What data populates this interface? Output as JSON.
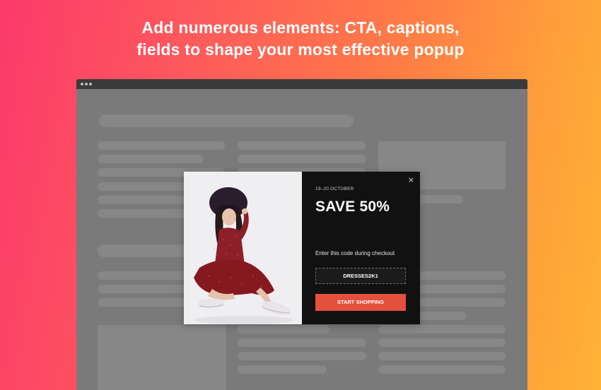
{
  "headline": {
    "line1": "Add numerous elements: CTA, captions,",
    "line2": "fields to shape your most effective popup"
  },
  "popup": {
    "date": "19–20 OCTOBER",
    "title": "SAVE 50%",
    "instruction": "Enter this code during checkout",
    "code": "DRESSES2K1",
    "cta_label": "START SHOPPING",
    "close_symbol": "×",
    "accent_color": "#e4503c",
    "panel_color": "#111112",
    "image_subject": "woman in red polka-dot dress and black hat sitting"
  },
  "background_gradient": [
    "#fb3a6b",
    "#ffb235"
  ]
}
